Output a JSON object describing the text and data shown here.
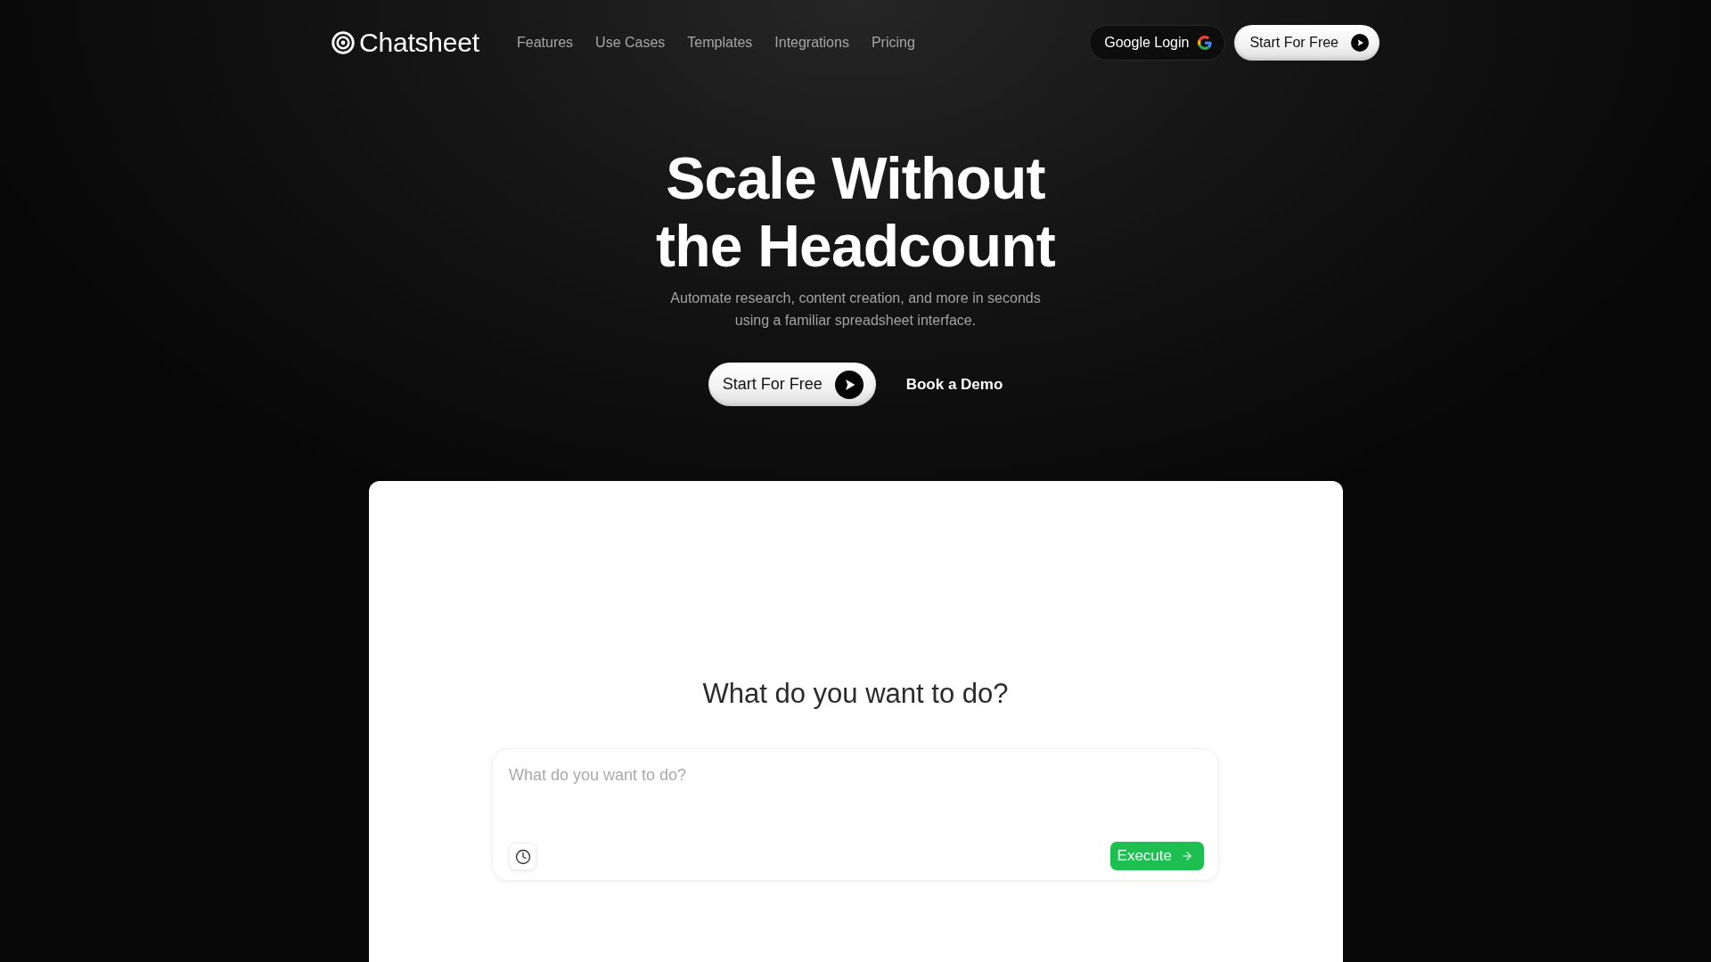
{
  "nav": {
    "brand": "Chatsheet",
    "links": [
      "Features",
      "Use Cases",
      "Templates",
      "Integrations",
      "Pricing"
    ],
    "login_button": "Google Login",
    "start_button": "Start For Free"
  },
  "hero": {
    "title": "Scale Without the Headcount",
    "subtitle": "Automate research, content creation, and more in seconds using a familiar spreadsheet interface.",
    "primary_button": "Start For Free",
    "secondary_link": "Book a Demo"
  },
  "panel": {
    "heading": "What do you want to do?",
    "prompt": {
      "placeholder": "What do you want to do?"
    },
    "execute_button": "Execute"
  }
}
